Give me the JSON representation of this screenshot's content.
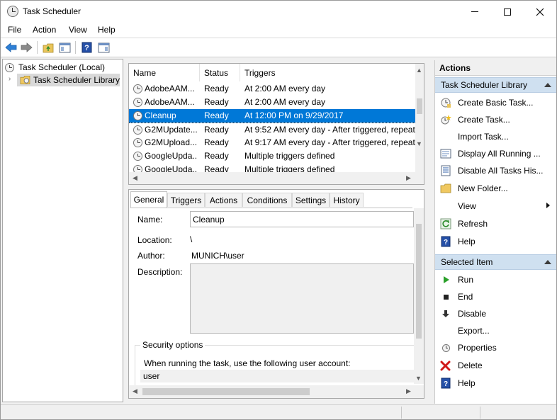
{
  "window": {
    "title": "Task Scheduler"
  },
  "menu": [
    "File",
    "Action",
    "View",
    "Help"
  ],
  "tree": {
    "root": "Task Scheduler (Local)",
    "library": "Task Scheduler Library"
  },
  "tasks": {
    "columns": [
      "Name",
      "Status",
      "Triggers"
    ],
    "rows": [
      {
        "name": "AdobeAAM...",
        "status": "Ready",
        "triggers": "At 2:00 AM every day"
      },
      {
        "name": "AdobeAAM...",
        "status": "Ready",
        "triggers": "At 2:00 AM every day"
      },
      {
        "name": "Cleanup",
        "status": "Ready",
        "triggers": "At 12:00 PM on 9/29/2017"
      },
      {
        "name": "G2MUpdate...",
        "status": "Ready",
        "triggers": "At 9:52 AM every day - After triggered, repeat"
      },
      {
        "name": "G2MUpload...",
        "status": "Ready",
        "triggers": "At 9:17 AM every day - After triggered, repeat"
      },
      {
        "name": "GoogleUpda...",
        "status": "Ready",
        "triggers": "Multiple triggers defined"
      },
      {
        "name": "GoogleUpda...",
        "status": "Ready",
        "triggers": "Multiple triggers defined"
      }
    ]
  },
  "tabs": [
    "General",
    "Triggers",
    "Actions",
    "Conditions",
    "Settings",
    "History"
  ],
  "general": {
    "name_label": "Name:",
    "name_value": "Cleanup",
    "location_label": "Location:",
    "location_value": "\\",
    "author_label": "Author:",
    "author_value": "MUNICH\\user",
    "description_label": "Description:",
    "security_heading": "Security options",
    "security_text": "When running the task, use the following user account:",
    "security_user": "user"
  },
  "actions": {
    "header": "Actions",
    "library_section": "Task Scheduler Library",
    "library_items": [
      {
        "label": "Create Basic Task...",
        "icon": "create-basic-task-icon"
      },
      {
        "label": "Create Task...",
        "icon": "create-task-icon"
      },
      {
        "label": "Import Task...",
        "icon": "import-icon"
      },
      {
        "label": "Display All Running ...",
        "icon": "display-running-icon"
      },
      {
        "label": "Disable All Tasks His...",
        "icon": "disable-history-icon"
      },
      {
        "label": "New Folder...",
        "icon": "folder-icon"
      },
      {
        "label": "View",
        "icon": ""
      },
      {
        "label": "Refresh",
        "icon": "refresh-icon"
      },
      {
        "label": "Help",
        "icon": "help-icon"
      }
    ],
    "selected_section": "Selected Item",
    "selected_items": [
      {
        "label": "Run",
        "icon": "run-icon"
      },
      {
        "label": "End",
        "icon": "end-icon"
      },
      {
        "label": "Disable",
        "icon": "disable-icon"
      },
      {
        "label": "Export...",
        "icon": ""
      },
      {
        "label": "Properties",
        "icon": "properties-icon"
      },
      {
        "label": "Delete",
        "icon": "delete-icon"
      },
      {
        "label": "Help",
        "icon": "help-icon"
      }
    ]
  },
  "colors": {
    "selection": "#0078d7",
    "section_header": "#cfe0f0",
    "run_green": "#2aa02a",
    "delete_red": "#d01818",
    "help_blue": "#1f4fa8"
  }
}
